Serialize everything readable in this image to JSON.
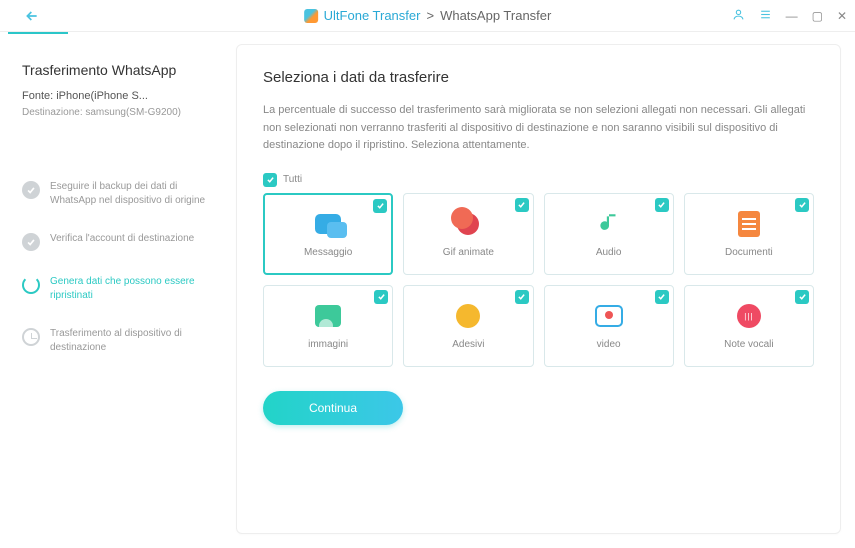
{
  "titlebar": {
    "app": "UltFone Transfer",
    "sep": ">",
    "section": "WhatsApp Transfer"
  },
  "sidebar": {
    "title": "Trasferimento WhatsApp",
    "source_label": "Fonte: iPhone(iPhone S...",
    "dest_label": "Destinazione: samsung(SM-G9200)",
    "steps": [
      {
        "text": "Eseguire il backup dei dati di WhatsApp nel dispositivo di origine",
        "state": "done"
      },
      {
        "text": "Verifica l'account di destinazione",
        "state": "done"
      },
      {
        "text": "Genera dati che possono essere ripristinati",
        "state": "current"
      },
      {
        "text": "Trasferimento al dispositivo di destinazione",
        "state": "future"
      }
    ]
  },
  "main": {
    "heading": "Seleziona i dati da trasferire",
    "desc": "La percentuale di successo del trasferimento sarà migliorata se non selezioni allegati non necessari. Gli allegati non selezionati non verranno trasferiti al dispositivo di destinazione e non saranno visibili sul dispositivo di destinazione dopo il ripristino. Seleziona attentamente.",
    "all_label": "Tutti",
    "cards": [
      {
        "label": "Messaggio",
        "selected": true
      },
      {
        "label": "Gif animate",
        "selected": false
      },
      {
        "label": "Audio",
        "selected": false
      },
      {
        "label": "Documenti",
        "selected": false
      },
      {
        "label": "immagini",
        "selected": false
      },
      {
        "label": "Adesivi",
        "selected": false
      },
      {
        "label": "video",
        "selected": false
      },
      {
        "label": "Note vocali",
        "selected": false
      }
    ],
    "continue": "Continua"
  }
}
